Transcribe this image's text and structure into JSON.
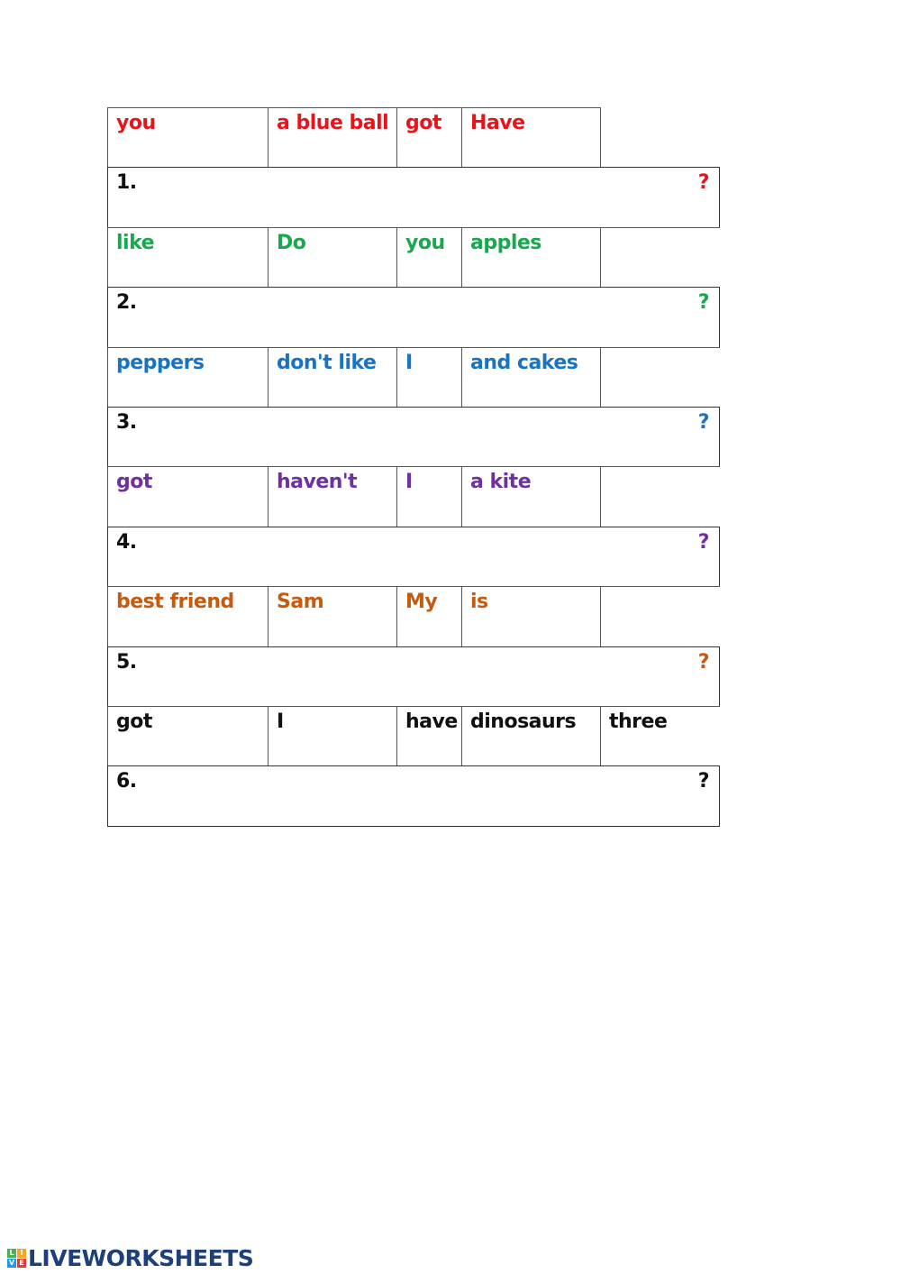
{
  "colors": {
    "red": "#e8141c",
    "green": "#1aa84f",
    "blue": "#1a73c2",
    "purple": "#7030a0",
    "orange": "#c55a11",
    "black": "#111111",
    "logo": "#1d3f7a"
  },
  "exercises": [
    {
      "number": "1.",
      "words": [
        "you",
        "a blue ball",
        "got",
        "Have"
      ],
      "color": "#e8141c",
      "end_mark": "?",
      "fifth_cell": false
    },
    {
      "number": "2.",
      "words": [
        "like",
        "Do",
        "you",
        "apples",
        ""
      ],
      "color": "#1aa84f",
      "end_mark": "?",
      "fifth_cell": true
    },
    {
      "number": "3.",
      "words": [
        "peppers",
        "don't like",
        "I",
        "and cakes",
        ""
      ],
      "color": "#1a73c2",
      "end_mark": "?",
      "fifth_cell": true
    },
    {
      "number": "4.",
      "words": [
        "got",
        "haven't",
        "I",
        "a kite",
        ""
      ],
      "color": "#7030a0",
      "end_mark": "?",
      "fifth_cell": true
    },
    {
      "number": "5.",
      "words": [
        "best friend",
        "Sam",
        "My",
        "is",
        ""
      ],
      "color": "#c55a11",
      "end_mark": "?",
      "fifth_cell": true
    },
    {
      "number": "6.",
      "words": [
        "got",
        "I",
        "have",
        "dinosaurs",
        "three"
      ],
      "color": "#111111",
      "end_mark": "?",
      "fifth_cell": true
    }
  ],
  "footer": {
    "logo_text": "LIVEWORKSHEETS",
    "logo_blocks": [
      {
        "letter": "L",
        "color": "#4caf50"
      },
      {
        "letter": "I",
        "color": "#f5a623"
      },
      {
        "letter": "V",
        "color": "#2196f3"
      },
      {
        "letter": "E",
        "color": "#e53935"
      }
    ]
  }
}
